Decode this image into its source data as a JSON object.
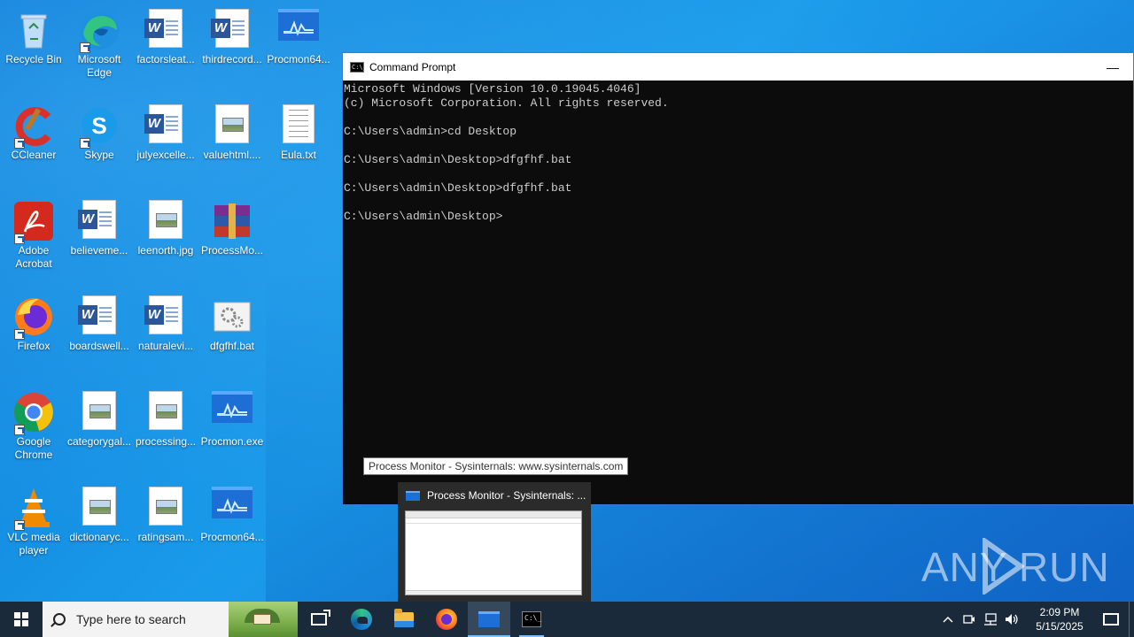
{
  "desktop": {
    "icons": [
      {
        "label": "Recycle Bin",
        "kind": "recycle"
      },
      {
        "label": "Microsoft Edge",
        "kind": "edge"
      },
      {
        "label": "factorsleat...",
        "kind": "word"
      },
      {
        "label": "thirdrecord...",
        "kind": "word"
      },
      {
        "label": "Procmon64...",
        "kind": "procmon"
      },
      {
        "label": "CCleaner",
        "kind": "ccleaner"
      },
      {
        "label": "Skype",
        "kind": "skype"
      },
      {
        "label": "julyexcelle...",
        "kind": "word"
      },
      {
        "label": "valuehtml....",
        "kind": "image"
      },
      {
        "label": "Eula.txt",
        "kind": "text"
      },
      {
        "label": "Adobe Acrobat",
        "kind": "acrobat"
      },
      {
        "label": "believeme...",
        "kind": "word"
      },
      {
        "label": "leenorth.jpg",
        "kind": "image"
      },
      {
        "label": "ProcessMo...",
        "kind": "winrar"
      },
      {
        "label": "Firefox",
        "kind": "firefox"
      },
      {
        "label": "boardswell...",
        "kind": "word"
      },
      {
        "label": "naturalevi...",
        "kind": "word"
      },
      {
        "label": "dfgfhf.bat",
        "kind": "bat"
      },
      {
        "label": "Google Chrome",
        "kind": "chrome"
      },
      {
        "label": "categorygal...",
        "kind": "image"
      },
      {
        "label": "processing...",
        "kind": "image"
      },
      {
        "label": "Procmon.exe",
        "kind": "procmon"
      },
      {
        "label": "VLC media player",
        "kind": "vlc"
      },
      {
        "label": "dictionaryc...",
        "kind": "image"
      },
      {
        "label": "ratingsam...",
        "kind": "image"
      },
      {
        "label": "Procmon64...",
        "kind": "procmon"
      }
    ]
  },
  "cmd_window": {
    "title": "Command Prompt",
    "minimize_glyph": "—",
    "icon_text": "C:\\_",
    "lines": [
      "Microsoft Windows [Version 10.0.19045.4046]",
      "(c) Microsoft Corporation. All rights reserved.",
      "",
      "C:\\Users\\admin>cd Desktop",
      "",
      "C:\\Users\\admin\\Desktop>dfgfhf.bat",
      "",
      "C:\\Users\\admin\\Desktop>dfgfhf.bat",
      "",
      "C:\\Users\\admin\\Desktop>"
    ]
  },
  "tooltip": {
    "text": "Process Monitor - Sysinternals: www.sysinternals.com"
  },
  "thumbnail": {
    "title": "Process Monitor - Sysinternals: ..."
  },
  "watermark": {
    "left": "ANY",
    "right": "RUN"
  },
  "taskbar": {
    "search_placeholder": "Type here to search",
    "time": "2:09 PM",
    "date": "5/15/2025",
    "tray_icons": [
      "chevron-up-icon",
      "meet-now-icon",
      "network-icon",
      "volume-icon"
    ]
  },
  "colors": {
    "desktop_accent": "#1a9bea",
    "taskbar": "#1b2a3a",
    "console_bg": "#0c0c0c",
    "console_text": "#cccccc"
  }
}
